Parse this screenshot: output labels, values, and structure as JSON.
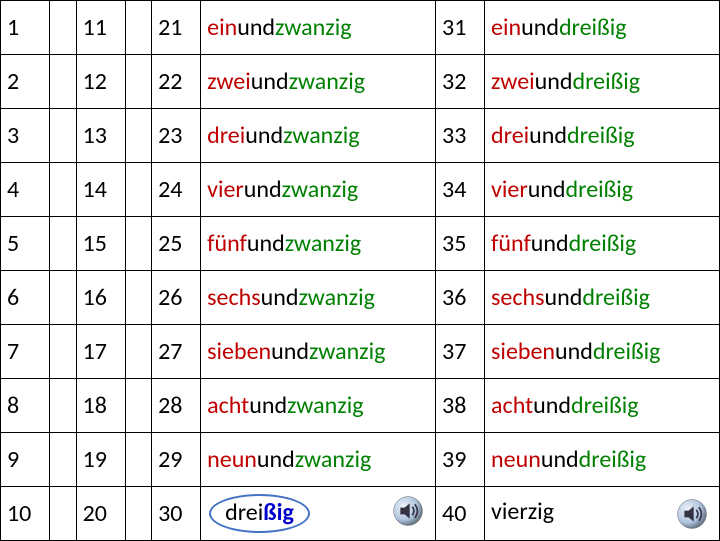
{
  "rows": [
    {
      "n1": "1",
      "n2": "11",
      "n3": "21",
      "w1": {
        "a": "ein",
        "b": "und",
        "c": "zwanzig"
      },
      "n4": "31",
      "w2": {
        "a": "ein",
        "b": "und",
        "c": "dreißig"
      }
    },
    {
      "n1": "2",
      "n2": "12",
      "n3": "22",
      "w1": {
        "a": "zwei",
        "b": "und",
        "c": "zwanzig"
      },
      "n4": "32",
      "w2": {
        "a": "zwei",
        "b": "und",
        "c": "dreißig"
      }
    },
    {
      "n1": "3",
      "n2": "13",
      "n3": "23",
      "w1": {
        "a": "drei",
        "b": "und",
        "c": "zwanzig"
      },
      "n4": "33",
      "w2": {
        "a": "drei",
        "b": "und",
        "c": "dreißig"
      }
    },
    {
      "n1": "4",
      "n2": "14",
      "n3": "24",
      "w1": {
        "a": "vier",
        "b": "und",
        "c": "zwanzig"
      },
      "n4": "34",
      "w2": {
        "a": "vier",
        "b": "und",
        "c": "dreißig"
      }
    },
    {
      "n1": "5",
      "n2": "15",
      "n3": "25",
      "w1": {
        "a": "fünf",
        "b": "und",
        "c": "zwanzig"
      },
      "n4": "35",
      "w2": {
        "a": "fünf",
        "b": "und",
        "c": "dreißig"
      }
    },
    {
      "n1": "6",
      "n2": "16",
      "n3": "26",
      "w1": {
        "a": "sechs",
        "b": "und",
        "c": "zwanzig"
      },
      "n4": "36",
      "w2": {
        "a": "sechs",
        "b": "und",
        "c": "dreißig"
      }
    },
    {
      "n1": "7",
      "n2": "17",
      "n3": "27",
      "w1": {
        "a": "sieben",
        "b": "und",
        "c": "zwanzig"
      },
      "n4": "37",
      "w2": {
        "a": "sieben",
        "b": "und",
        "c": "dreißig"
      }
    },
    {
      "n1": "8",
      "n2": "18",
      "n3": "28",
      "w1": {
        "a": "acht",
        "b": "und",
        "c": "zwanzig"
      },
      "n4": "38",
      "w2": {
        "a": "acht",
        "b": "und",
        "c": "dreißig"
      }
    },
    {
      "n1": "9",
      "n2": "19",
      "n3": "29",
      "w1": {
        "a": "neun",
        "b": "und",
        "c": "zwanzig"
      },
      "n4": "39",
      "w2": {
        "a": "neun",
        "b": "und",
        "c": "dreißig"
      }
    },
    {
      "n1": "10",
      "n2": "20",
      "n3": "30",
      "w3": {
        "p": "drei",
        "s": "ßig"
      },
      "speaker1": true,
      "n4": "40",
      "w4": "vierzig",
      "speaker2": true
    }
  ]
}
